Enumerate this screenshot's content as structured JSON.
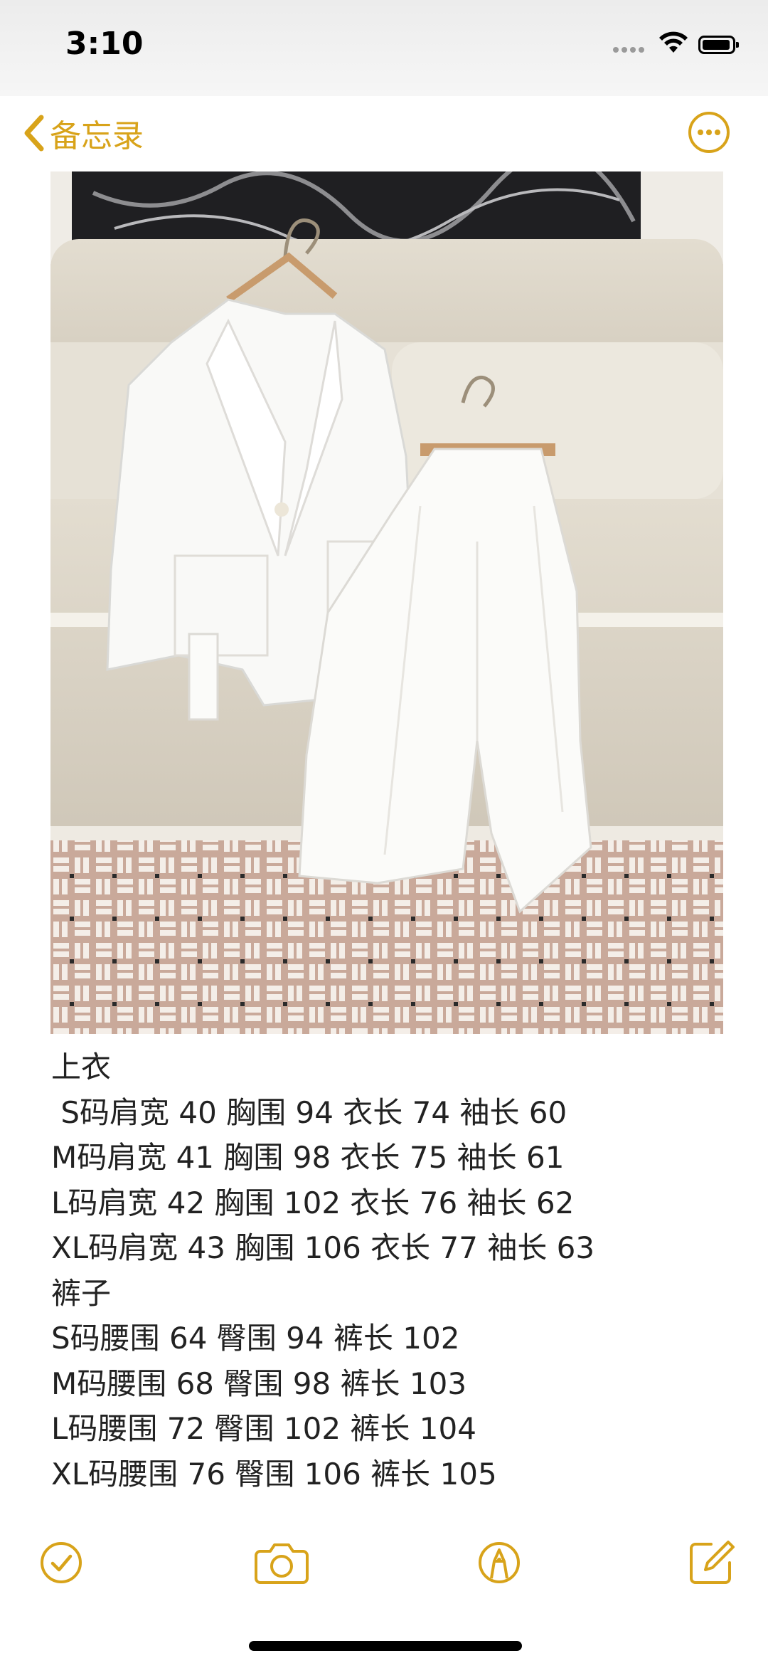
{
  "status_bar": {
    "time": "3:10",
    "icons": [
      "signal-dots-icon",
      "wifi-icon",
      "battery-icon"
    ]
  },
  "nav": {
    "back_label": "备忘录",
    "back_icon": "chevron-left-icon",
    "more_icon": "ellipsis-circle-icon",
    "accent_color": "#d8a31a"
  },
  "photo": {
    "description_icon": "clothing-photo"
  },
  "note": {
    "lines": [
      "上衣",
      " S码肩宽 40 胸围 94 衣长 74 袖长 60",
      "M码肩宽 41 胸围 98 衣长 75 袖长 61",
      "L码肩宽 42 胸围 102 衣长 76 袖长 62",
      "XL码肩宽 43 胸围 106 衣长 77 袖长 63",
      "裤子",
      "S码腰围 64 臀围 94 裤长 102",
      "M码腰围 68 臀围 98 裤长 103",
      "L码腰围 72 臀围 102 裤长 104",
      "XL码腰围 76 臀围 106 裤长 105"
    ]
  },
  "toolbar": {
    "items": [
      "checklist-icon",
      "camera-icon",
      "markup-icon",
      "compose-icon"
    ]
  }
}
